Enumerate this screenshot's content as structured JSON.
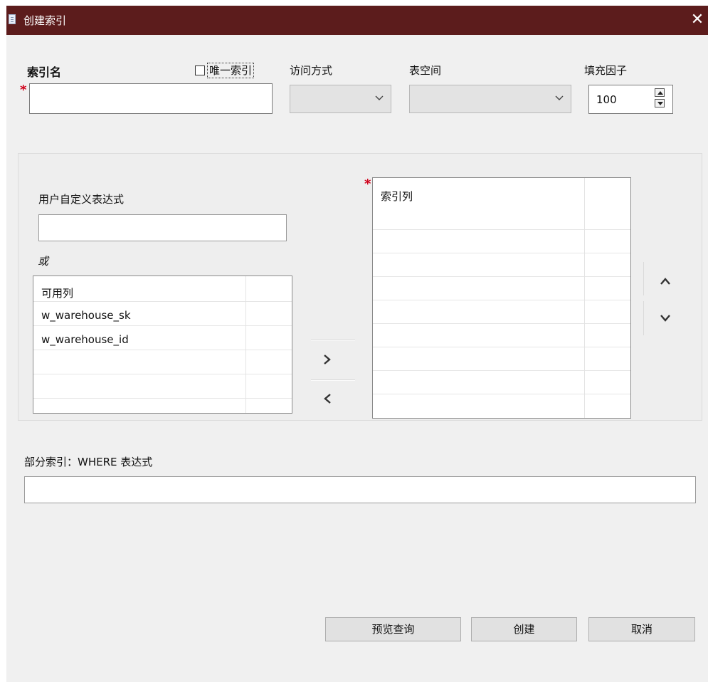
{
  "window": {
    "title": "创建索引",
    "close_symbol": "✕",
    "titlebar_color": "#5c1c1c"
  },
  "form": {
    "index_name_label": "索引名",
    "index_name_value": "",
    "unique_label": "唯一索引",
    "unique_checked": false,
    "access_method_label": "访问方式",
    "access_method_value": "",
    "tablespace_label": "表空间",
    "tablespace_value": "",
    "fill_factor_label": "填充因子",
    "fill_factor_value": "100",
    "required_marker": "*"
  },
  "columns_panel": {
    "custom_expr_label": "用户自定义表达式",
    "custom_expr_value": "",
    "or_label": "或",
    "available_header": "可用列",
    "available_items": [
      "w_warehouse_sk",
      "w_warehouse_id"
    ],
    "index_columns_header": "索引列",
    "index_columns_items": []
  },
  "where": {
    "label": "部分索引：WHERE 表达式",
    "value": ""
  },
  "buttons": {
    "preview": "预览查询",
    "create": "创建",
    "cancel": "取消"
  },
  "icons": {
    "title": "document-icon",
    "add": "chevron-right-icon",
    "remove": "chevron-left-icon",
    "up": "chevron-up-icon",
    "down": "chevron-down-icon"
  }
}
